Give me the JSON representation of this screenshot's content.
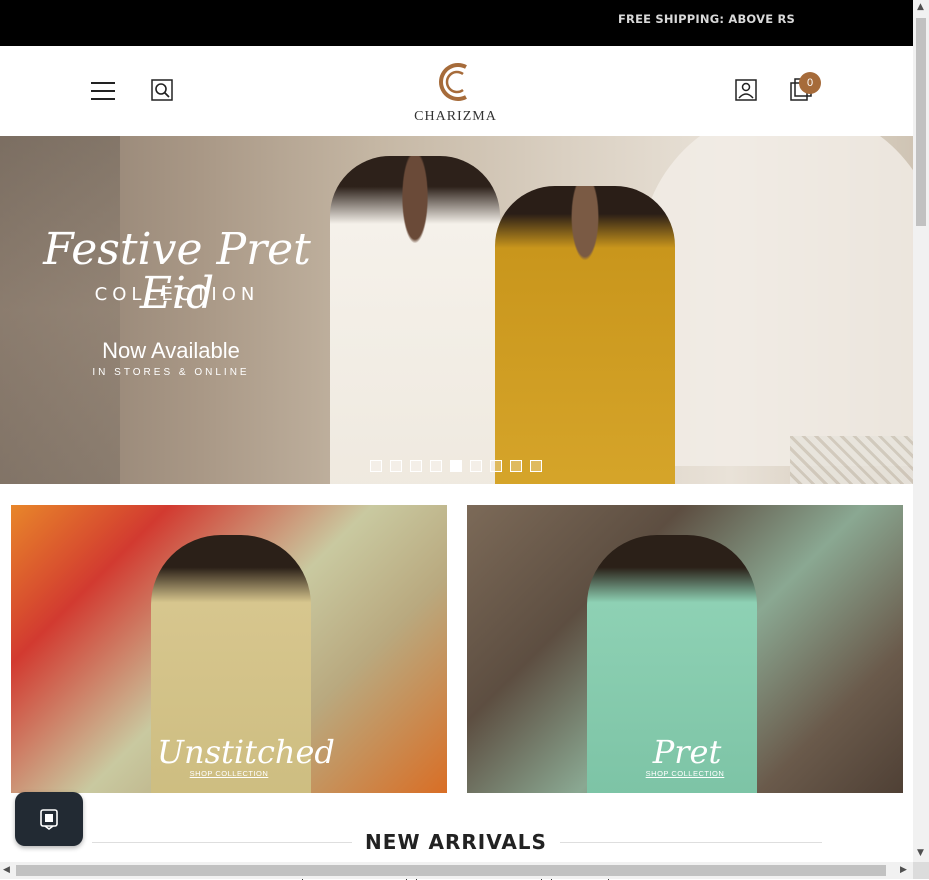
{
  "announcement": {
    "text": "FREE SHIPPING: ABOVE RS"
  },
  "header": {
    "logo_text": "CHARIZMA",
    "cart_count": "0",
    "accent_color": "#a66b3a"
  },
  "hero": {
    "title": "Festive Pret Eid",
    "subtitle": "COLLECTION",
    "cta_line": "Now Available",
    "cta_sub": "IN STORES & ONLINE",
    "slide_count": 9,
    "active_slide": 4
  },
  "collections": [
    {
      "name": "Unstitched",
      "link": "SHOP COLLECTION"
    },
    {
      "name": "Pret",
      "link": "SHOP COLLECTION"
    }
  ],
  "new_arrivals": {
    "title": "NEW ARRIVALS"
  },
  "icons": {
    "menu": "hamburger-menu-icon",
    "search": "search-icon",
    "account": "user-icon",
    "cart": "shopping-bag-icon",
    "chat": "chat-icon"
  }
}
